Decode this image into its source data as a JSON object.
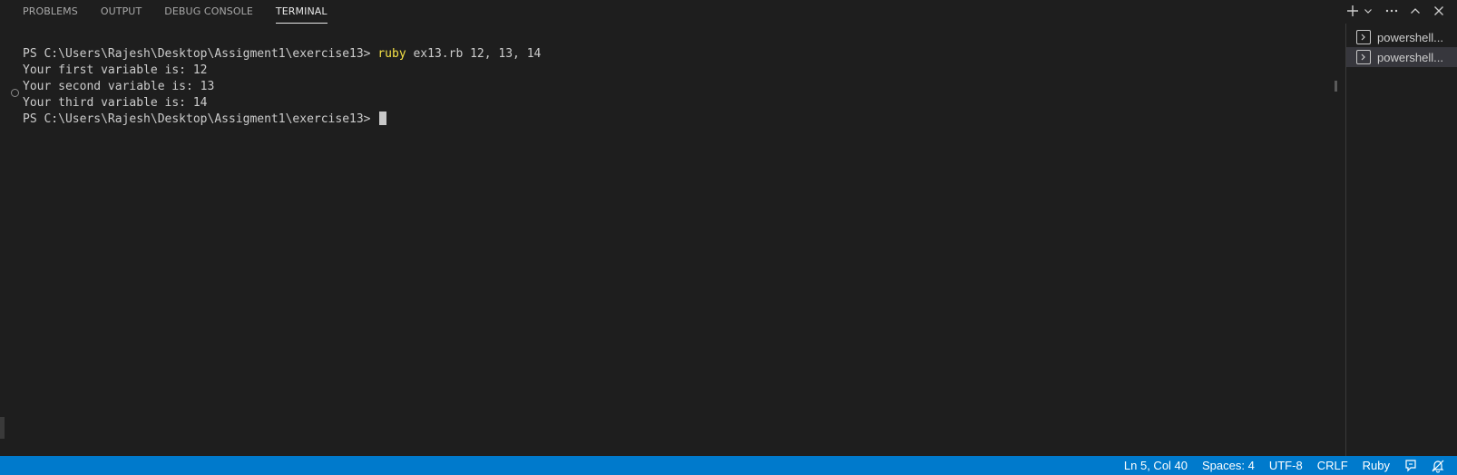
{
  "panel": {
    "tabs": [
      "PROBLEMS",
      "OUTPUT",
      "DEBUG CONSOLE",
      "TERMINAL"
    ],
    "active_tab": "TERMINAL"
  },
  "terminal": {
    "prompt": "PS C:\\Users\\Rajesh\\Desktop\\Assigment1\\exercise13> ",
    "command_keyword": "ruby",
    "command_args": " ex13.rb 12, 13, 14",
    "output": [
      "Your first variable is: 12",
      "Your second variable is: 13",
      "Your third variable is: 14"
    ]
  },
  "terminal_list": {
    "items": [
      "powershell...",
      "powershell..."
    ],
    "selected_index": 1
  },
  "status_bar": {
    "position": "Ln 5, Col 40",
    "spaces": "Spaces: 4",
    "encoding": "UTF-8",
    "eol": "CRLF",
    "language": "Ruby"
  },
  "icons": {
    "actions": [
      "add-icon",
      "chevron-down-icon",
      "more-icon",
      "chevron-up-icon",
      "close-icon"
    ],
    "status": [
      "feedback-icon",
      "bell-muted-icon"
    ]
  },
  "colors": {
    "background": "#1e1e1e",
    "status_bar": "#007acc",
    "command": "#f5e146",
    "selected_item": "#37373d"
  }
}
